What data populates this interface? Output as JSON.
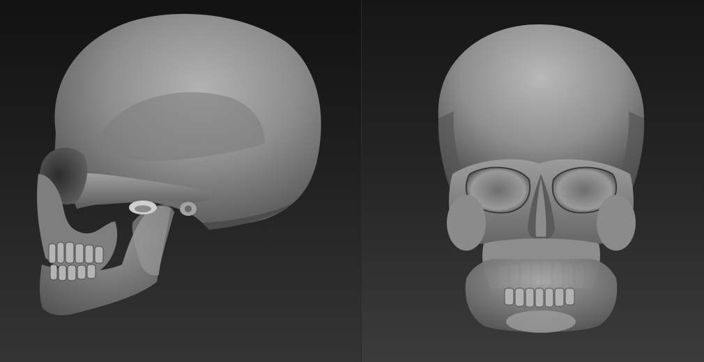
{
  "scene": {
    "background_top": "#141414",
    "background_bottom": "#3a3a3a",
    "material_light": "#a9a9a9",
    "material_mid": "#7a7a7a",
    "material_dark": "#3c3c3c"
  },
  "views": [
    {
      "id": "side",
      "subject": "skull-side-view"
    },
    {
      "id": "front",
      "subject": "skull-front-view"
    }
  ]
}
